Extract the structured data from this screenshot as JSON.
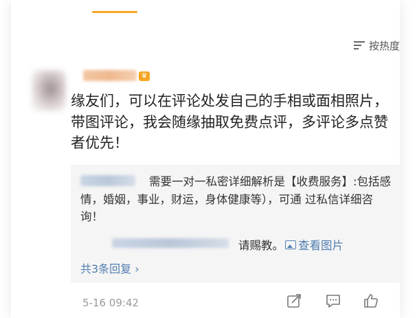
{
  "sort": {
    "label": "按热度"
  },
  "comment": {
    "text": "缘友们，可以在评论处发自己的手相或面相照片，带图评论，我会随缘抽取免费点评，多评论多点赞者优先！",
    "timestamp": "5-16 09:42"
  },
  "replies": [
    {
      "text": "需要一对一私密详细解析是【收费服务】:包括感情，婚姻，事业，财运，身体健康等），可通 过私信详细咨询！"
    },
    {
      "text": "请赐教。",
      "link": "查看图片"
    }
  ],
  "more_replies": "共3条回复 ›",
  "actions": {
    "forward_icon": "share-icon",
    "comment_icon": "comment-icon",
    "like_icon": "like-icon"
  },
  "colors": {
    "accent": "#f5a623",
    "link": "#507daf",
    "text": "#222222",
    "muted": "#999999",
    "reply_bg": "#f5f5f5"
  }
}
